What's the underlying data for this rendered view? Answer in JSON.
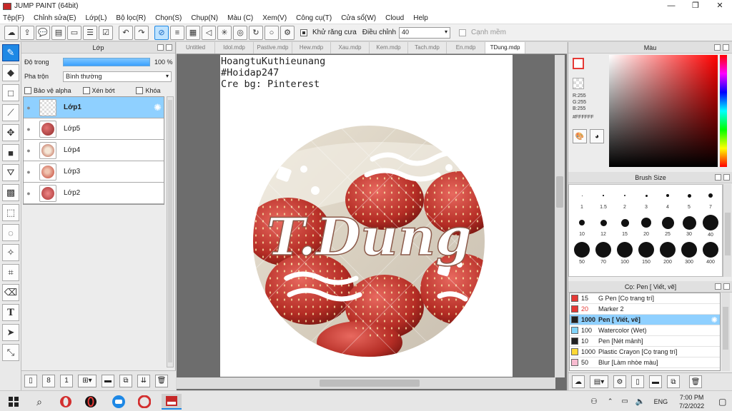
{
  "titlebar": {
    "title": "JUMP PAINT (64bit)",
    "minimize": "—",
    "maximize": "❐",
    "close": "✕"
  },
  "menu": [
    "Tệp(F)",
    "Chỉnh sửa(E)",
    "Lớp(L)",
    "Bộ lọc(R)",
    "Chọn(S)",
    "Chụp(N)",
    "Màu (C)",
    "Xem(V)",
    "Công cụ(T)",
    "Cửa sổ(W)",
    "Cloud",
    "Help"
  ],
  "toolbar": {
    "antialias_label": "Khử răng cưa",
    "adjust_label": "Điều chỉnh",
    "adjust_value": "40",
    "smooth_label": "Cạnh mềm"
  },
  "layers_panel": {
    "title": "Lớp",
    "opacity_label": "Độ trong",
    "opacity_value": "100 %",
    "opacity_fraction": 1.0,
    "blend_label": "Pha trộn",
    "blend_value": "Bình thường",
    "protect_alpha": "Bảo vệ alpha",
    "clipping": "Xén bớt",
    "lock": "Khóa",
    "layers": [
      {
        "name": "Lớp1",
        "selected": true
      },
      {
        "name": "Lớp5",
        "selected": false
      },
      {
        "name": "Lớp4",
        "selected": false
      },
      {
        "name": "Lớp3",
        "selected": false
      },
      {
        "name": "Lớp2",
        "selected": false
      }
    ]
  },
  "canvas": {
    "tabs": [
      "Untitled",
      "Idol.mdp",
      "Pastive.mdp",
      "Hew.mdp",
      "Xau.mdp",
      "Kem.mdp",
      "Tach.mdp",
      "En.mdp",
      "TDung.mdp"
    ],
    "active_tab": "TDung.mdp",
    "credits": [
      "HoangtuKuthieunang",
      "#Hoidap247",
      "Cre bg: Pinterest"
    ],
    "art_text": "T.Dung"
  },
  "color_panel": {
    "title": "Màu",
    "r": "R:255",
    "g": "G:255",
    "b": "B:255",
    "hex": "#FFFFFF",
    "fg_color": "#e53935"
  },
  "brush_size_panel": {
    "title": "Brush Size",
    "sizes": [
      "1",
      "1.5",
      "2",
      "3",
      "4",
      "5",
      "7",
      "10",
      "12",
      "15",
      "20",
      "25",
      "30",
      "40",
      "50",
      "70",
      "100",
      "150",
      "200",
      "300",
      "400"
    ]
  },
  "tool_settings": {
    "title": "Cọ: Pen [ Viết, vẽ]",
    "brushes": [
      {
        "size": "15",
        "name": "G Pen [Cọ trang trí]",
        "color": "#e53935",
        "size_color": "#222",
        "selected": false
      },
      {
        "size": "20",
        "name": "Marker 2",
        "color": "#e53935",
        "size_color": "#e53935",
        "selected": false
      },
      {
        "size": "1000",
        "name": "Pen [ Viết, vẽ]",
        "color": "#212121",
        "size_color": "#222",
        "selected": true
      },
      {
        "size": "100",
        "name": "Watercolor (Wet)",
        "color": "#81d4fa",
        "size_color": "#222",
        "selected": false
      },
      {
        "size": "10",
        "name": "Pen [Nét mảnh]",
        "color": "#212121",
        "size_color": "#222",
        "selected": false
      },
      {
        "size": "1000",
        "name": "Plastic Crayon [Cọ trang trí]",
        "color": "#fdd835",
        "size_color": "#222",
        "selected": false
      },
      {
        "size": "50",
        "name": "Blur [Làm nhòe màu]",
        "color": "#f8bbd0",
        "size_color": "#222",
        "selected": false
      }
    ]
  },
  "taskbar": {
    "lang": "ENG",
    "time": "7:00 PM",
    "date": "7/2/2022"
  }
}
